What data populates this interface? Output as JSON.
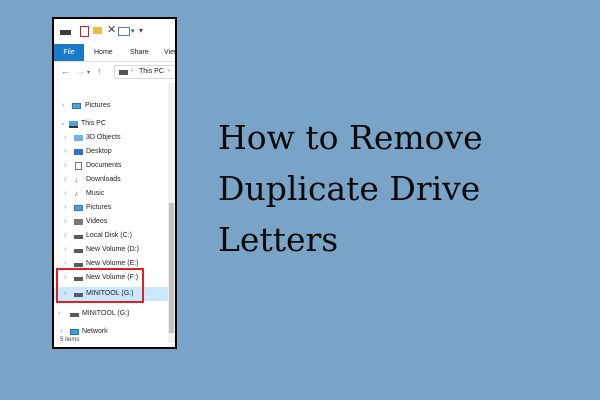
{
  "window": {
    "ribbon_tabs": [
      "File",
      "Home",
      "Share",
      "View"
    ],
    "address_path": "This PC",
    "status_text": "5 items"
  },
  "tree": {
    "items": [
      {
        "label": "Pictures",
        "icon": "picture-icon"
      },
      {
        "label": "This PC",
        "icon": "computer-icon"
      },
      {
        "label": "3D Objects",
        "icon": "cube-icon"
      },
      {
        "label": "Desktop",
        "icon": "desktop-icon"
      },
      {
        "label": "Documents",
        "icon": "document-icon"
      },
      {
        "label": "Downloads",
        "icon": "download-icon"
      },
      {
        "label": "Music",
        "icon": "music-icon"
      },
      {
        "label": "Pictures",
        "icon": "picture-icon"
      },
      {
        "label": "Videos",
        "icon": "video-icon"
      },
      {
        "label": "Local Disk (C:)",
        "icon": "drive-icon"
      },
      {
        "label": "New Volume (D:)",
        "icon": "drive-icon"
      },
      {
        "label": "New Volume (E:)",
        "icon": "drive-icon"
      },
      {
        "label": "New Volume (F:)",
        "icon": "drive-icon"
      },
      {
        "label": "MINITOOL (G:)",
        "icon": "drive-icon",
        "selected": true
      },
      {
        "label": "MINITOOL (G:)",
        "icon": "drive-icon"
      },
      {
        "label": "Network",
        "icon": "network-icon"
      }
    ]
  },
  "heading": {
    "line1": "How to Remove",
    "line2": "Duplicate Drive",
    "line3": "Letters"
  },
  "colors": {
    "background": "#7aa3c8",
    "file_tab": "#1979ca",
    "highlight_border": "#e02020",
    "selected_row": "#cce8ff"
  }
}
